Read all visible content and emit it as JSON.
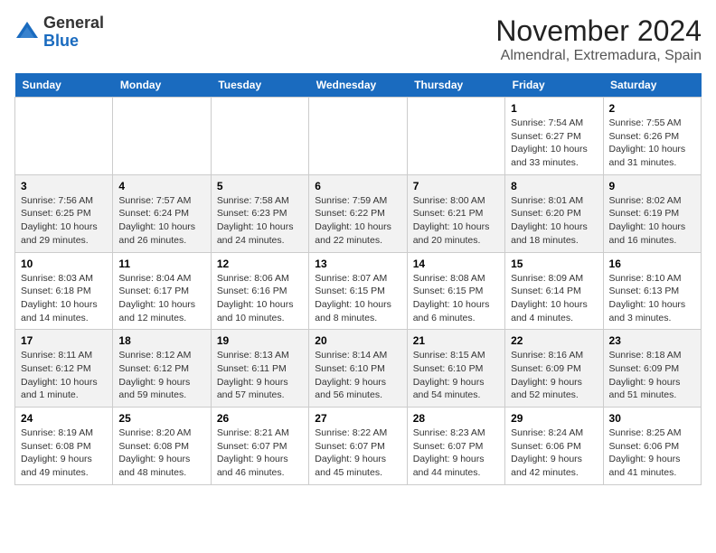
{
  "header": {
    "logo_general": "General",
    "logo_blue": "Blue",
    "month_title": "November 2024",
    "location": "Almendral, Extremadura, Spain"
  },
  "weekdays": [
    "Sunday",
    "Monday",
    "Tuesday",
    "Wednesday",
    "Thursday",
    "Friday",
    "Saturday"
  ],
  "weeks": [
    [
      {
        "day": "",
        "info": ""
      },
      {
        "day": "",
        "info": ""
      },
      {
        "day": "",
        "info": ""
      },
      {
        "day": "",
        "info": ""
      },
      {
        "day": "",
        "info": ""
      },
      {
        "day": "1",
        "info": "Sunrise: 7:54 AM\nSunset: 6:27 PM\nDaylight: 10 hours and 33 minutes."
      },
      {
        "day": "2",
        "info": "Sunrise: 7:55 AM\nSunset: 6:26 PM\nDaylight: 10 hours and 31 minutes."
      }
    ],
    [
      {
        "day": "3",
        "info": "Sunrise: 7:56 AM\nSunset: 6:25 PM\nDaylight: 10 hours and 29 minutes."
      },
      {
        "day": "4",
        "info": "Sunrise: 7:57 AM\nSunset: 6:24 PM\nDaylight: 10 hours and 26 minutes."
      },
      {
        "day": "5",
        "info": "Sunrise: 7:58 AM\nSunset: 6:23 PM\nDaylight: 10 hours and 24 minutes."
      },
      {
        "day": "6",
        "info": "Sunrise: 7:59 AM\nSunset: 6:22 PM\nDaylight: 10 hours and 22 minutes."
      },
      {
        "day": "7",
        "info": "Sunrise: 8:00 AM\nSunset: 6:21 PM\nDaylight: 10 hours and 20 minutes."
      },
      {
        "day": "8",
        "info": "Sunrise: 8:01 AM\nSunset: 6:20 PM\nDaylight: 10 hours and 18 minutes."
      },
      {
        "day": "9",
        "info": "Sunrise: 8:02 AM\nSunset: 6:19 PM\nDaylight: 10 hours and 16 minutes."
      }
    ],
    [
      {
        "day": "10",
        "info": "Sunrise: 8:03 AM\nSunset: 6:18 PM\nDaylight: 10 hours and 14 minutes."
      },
      {
        "day": "11",
        "info": "Sunrise: 8:04 AM\nSunset: 6:17 PM\nDaylight: 10 hours and 12 minutes."
      },
      {
        "day": "12",
        "info": "Sunrise: 8:06 AM\nSunset: 6:16 PM\nDaylight: 10 hours and 10 minutes."
      },
      {
        "day": "13",
        "info": "Sunrise: 8:07 AM\nSunset: 6:15 PM\nDaylight: 10 hours and 8 minutes."
      },
      {
        "day": "14",
        "info": "Sunrise: 8:08 AM\nSunset: 6:15 PM\nDaylight: 10 hours and 6 minutes."
      },
      {
        "day": "15",
        "info": "Sunrise: 8:09 AM\nSunset: 6:14 PM\nDaylight: 10 hours and 4 minutes."
      },
      {
        "day": "16",
        "info": "Sunrise: 8:10 AM\nSunset: 6:13 PM\nDaylight: 10 hours and 3 minutes."
      }
    ],
    [
      {
        "day": "17",
        "info": "Sunrise: 8:11 AM\nSunset: 6:12 PM\nDaylight: 10 hours and 1 minute."
      },
      {
        "day": "18",
        "info": "Sunrise: 8:12 AM\nSunset: 6:12 PM\nDaylight: 9 hours and 59 minutes."
      },
      {
        "day": "19",
        "info": "Sunrise: 8:13 AM\nSunset: 6:11 PM\nDaylight: 9 hours and 57 minutes."
      },
      {
        "day": "20",
        "info": "Sunrise: 8:14 AM\nSunset: 6:10 PM\nDaylight: 9 hours and 56 minutes."
      },
      {
        "day": "21",
        "info": "Sunrise: 8:15 AM\nSunset: 6:10 PM\nDaylight: 9 hours and 54 minutes."
      },
      {
        "day": "22",
        "info": "Sunrise: 8:16 AM\nSunset: 6:09 PM\nDaylight: 9 hours and 52 minutes."
      },
      {
        "day": "23",
        "info": "Sunrise: 8:18 AM\nSunset: 6:09 PM\nDaylight: 9 hours and 51 minutes."
      }
    ],
    [
      {
        "day": "24",
        "info": "Sunrise: 8:19 AM\nSunset: 6:08 PM\nDaylight: 9 hours and 49 minutes."
      },
      {
        "day": "25",
        "info": "Sunrise: 8:20 AM\nSunset: 6:08 PM\nDaylight: 9 hours and 48 minutes."
      },
      {
        "day": "26",
        "info": "Sunrise: 8:21 AM\nSunset: 6:07 PM\nDaylight: 9 hours and 46 minutes."
      },
      {
        "day": "27",
        "info": "Sunrise: 8:22 AM\nSunset: 6:07 PM\nDaylight: 9 hours and 45 minutes."
      },
      {
        "day": "28",
        "info": "Sunrise: 8:23 AM\nSunset: 6:07 PM\nDaylight: 9 hours and 44 minutes."
      },
      {
        "day": "29",
        "info": "Sunrise: 8:24 AM\nSunset: 6:06 PM\nDaylight: 9 hours and 42 minutes."
      },
      {
        "day": "30",
        "info": "Sunrise: 8:25 AM\nSunset: 6:06 PM\nDaylight: 9 hours and 41 minutes."
      }
    ]
  ]
}
